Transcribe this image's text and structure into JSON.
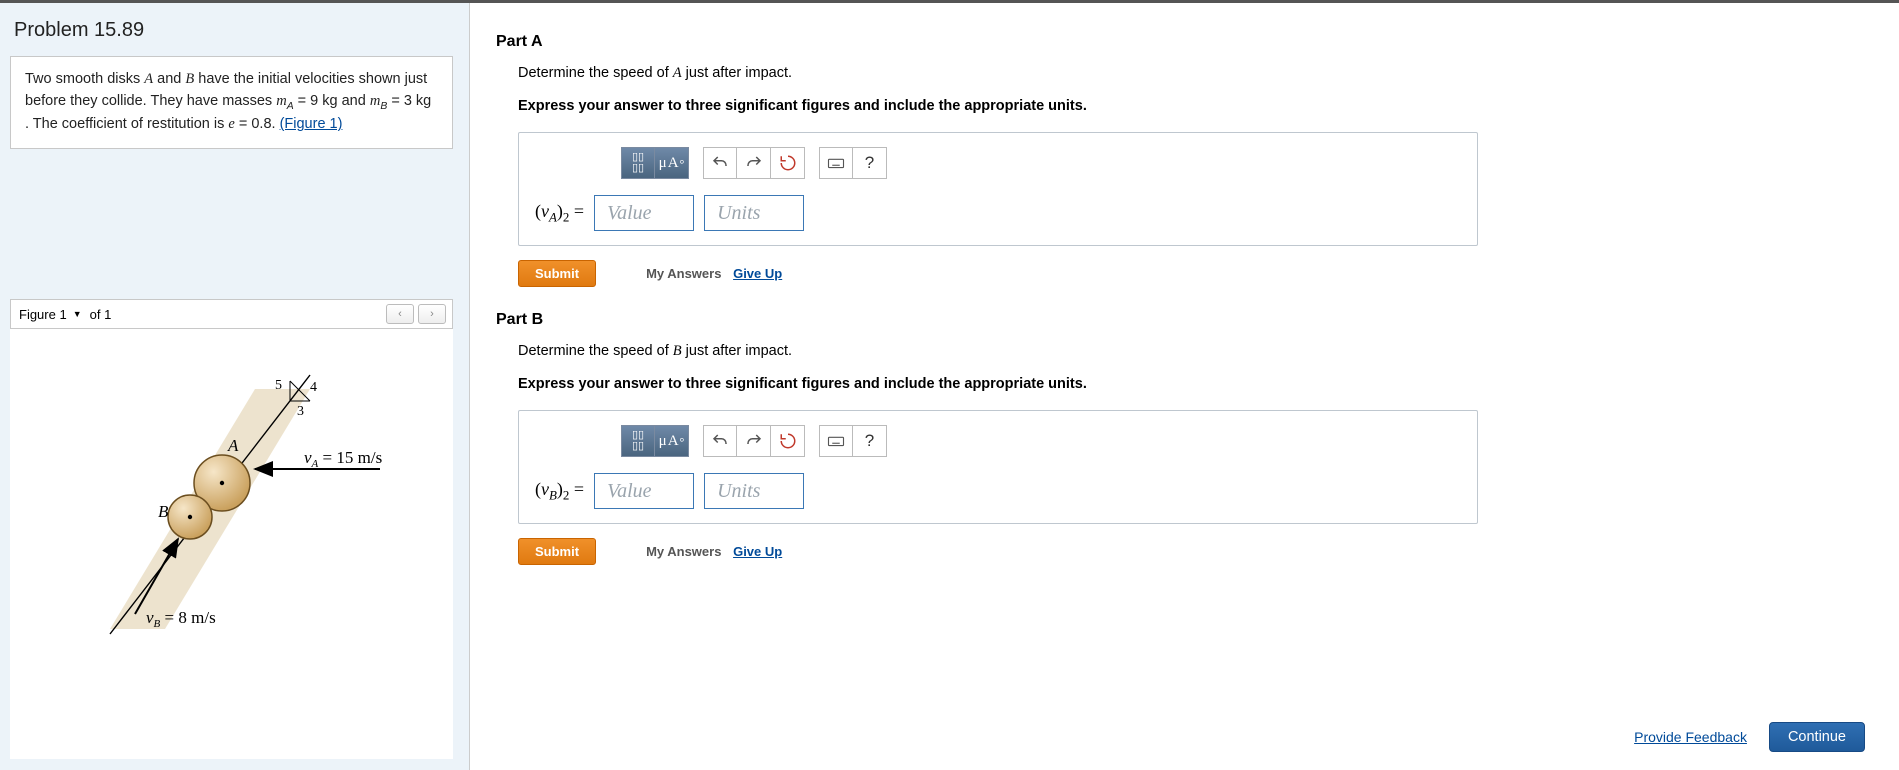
{
  "left": {
    "title": "Problem 15.89",
    "statement_prefix": "Two smooth disks ",
    "disk_a": "A",
    "statement_mid1": " and ",
    "disk_b": "B",
    "statement_mid2": " have the initial velocities shown just before they collide. They have masses ",
    "mA_sym_m": "m",
    "mA_sym_sub": "A",
    "mA_val": " = 9  kg",
    "and": " and ",
    "mB_sym_m": "m",
    "mB_sym_sub": "B",
    "mB_val": " = 3  kg",
    "statement_mid3": " . The coefficient of restitution is ",
    "e_sym": "e",
    "e_val": " = 0.8. ",
    "fig_link": "(Figure 1)",
    "fig_dropdown": "Figure 1",
    "fig_of": "of 1",
    "tri_5": "5",
    "tri_4": "4",
    "tri_3": "3",
    "label_A": "A",
    "label_B": "B",
    "va_eq": "v",
    "va_sub": "A",
    "va_val": " = 15 m/s",
    "vb_eq": "v",
    "vb_sub": "B",
    "vb_val": " = 8 m/s"
  },
  "parts": [
    {
      "title": "Part A",
      "prompt_pre": "Determine the speed of ",
      "prompt_sym": "A",
      "prompt_post": " just after impact.",
      "instr": "Express your answer to three significant figures and include the appropriate units.",
      "var_open": "(",
      "var_v": "v",
      "var_sub": "A",
      "var_close": ")",
      "var_sub2": "2",
      "equals": " = ",
      "value_ph": "Value",
      "units_ph": "Units",
      "submit": "Submit",
      "my_answers": "My Answers",
      "give_up": "Give Up"
    },
    {
      "title": "Part B",
      "prompt_pre": "Determine the speed of ",
      "prompt_sym": "B",
      "prompt_post": " just after impact.",
      "instr": "Express your answer to three significant figures and include the appropriate units.",
      "var_open": "(",
      "var_v": "v",
      "var_sub": "B",
      "var_close": ")",
      "var_sub2": "2",
      "equals": " = ",
      "value_ph": "Value",
      "units_ph": "Units",
      "submit": "Submit",
      "my_answers": "My Answers",
      "give_up": "Give Up"
    }
  ],
  "footer": {
    "feedback": "Provide Feedback",
    "continue": "Continue"
  },
  "icons": {
    "mu_a": "μÅ",
    "question": "?"
  }
}
